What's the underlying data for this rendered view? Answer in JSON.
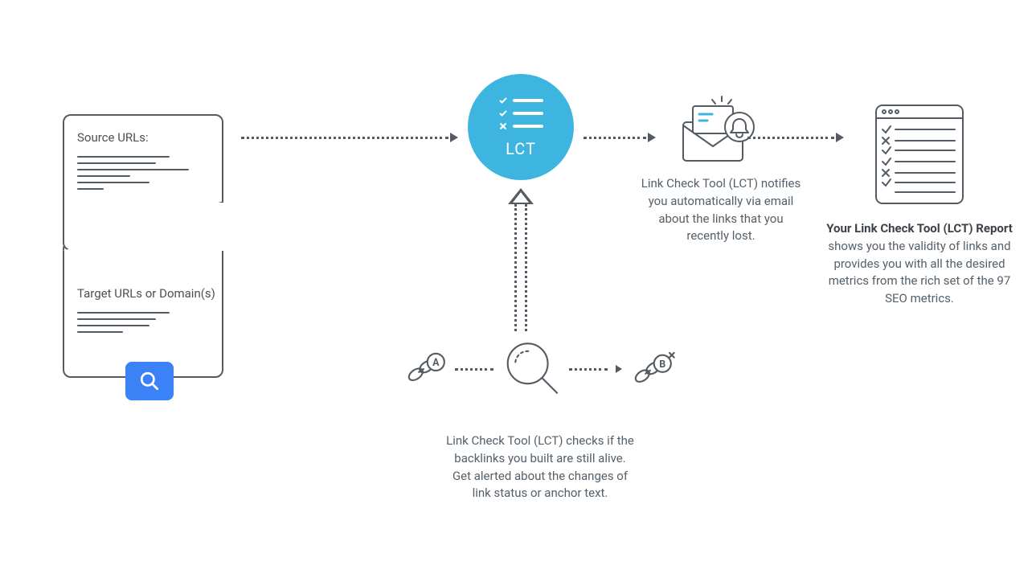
{
  "input": {
    "source_label": "Source URLs:",
    "target_label": "Target URLs or Domain(s)"
  },
  "lct": {
    "label": "LCT"
  },
  "email": {
    "caption": "Link Check Tool (LCT) notifies you automatically via email about the links that you recently lost."
  },
  "report": {
    "title": "Your Link Check Tool (LCT) Report",
    "caption": "shows you the validity of links and provides you with all the desired metrics from the rich set of the 97 SEO metrics."
  },
  "check": {
    "node_a": "A",
    "node_b": "B",
    "caption_l1": "Link Check Tool (LCT) checks if the",
    "caption_l2": "backlinks you built are still alive.",
    "caption_l3": "Get alerted about the changes of",
    "caption_l4": "link status or anchor text."
  }
}
